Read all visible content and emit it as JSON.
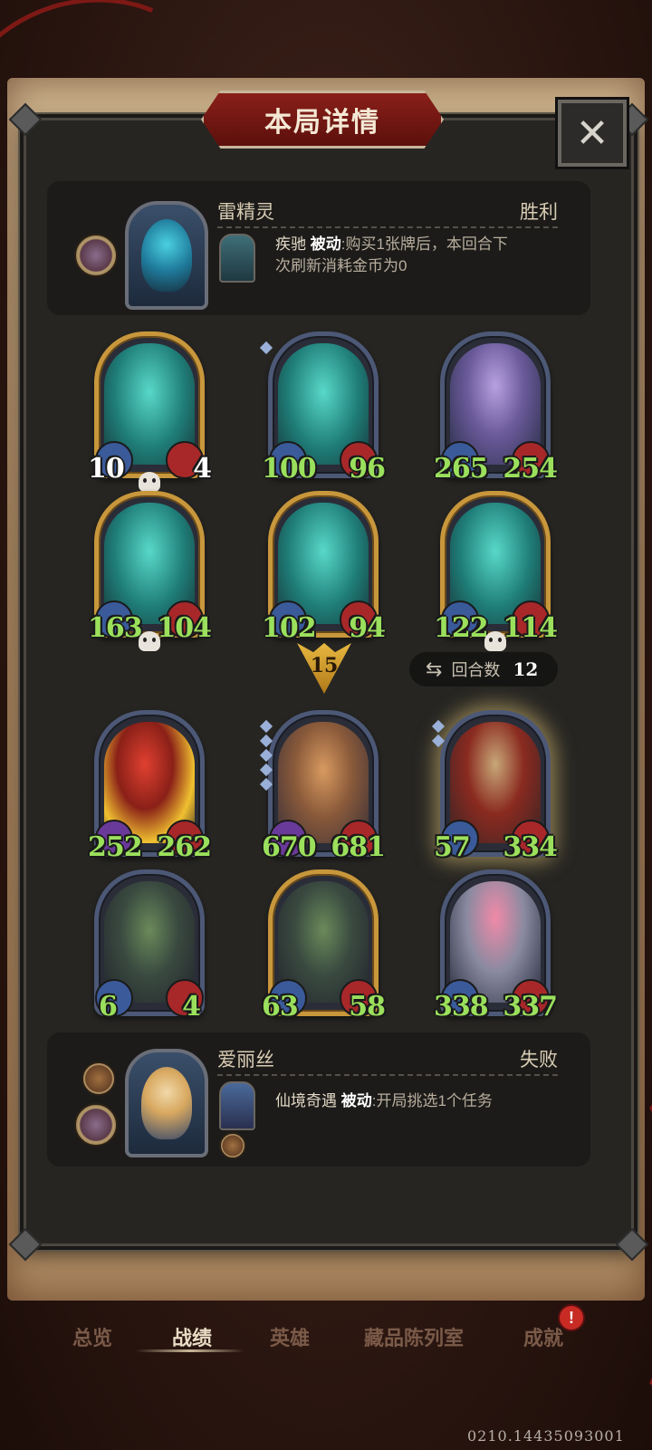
{
  "header": {
    "title": "本局详情",
    "close_label": "✕"
  },
  "top_player": {
    "name": "雷精灵",
    "result": "胜利",
    "skill_name": "疾驰",
    "skill_type": "被动",
    "skill_desc_line1": ":购买1张牌后，本回合下",
    "skill_desc_line2": "次刷新消耗金币为0"
  },
  "top_units": [
    {
      "attack": "10",
      "health": "4"
    },
    {
      "attack": "100",
      "health": "96"
    },
    {
      "attack": "265",
      "health": "254"
    },
    {
      "attack": "163",
      "health": "104"
    },
    {
      "attack": "102",
      "health": "94"
    },
    {
      "attack": "122",
      "health": "114"
    }
  ],
  "divider": {
    "turn_marker": "15",
    "rounds_label": "回合数",
    "rounds_value": "12"
  },
  "bottom_units": [
    {
      "attack": "252",
      "health": "262"
    },
    {
      "attack": "670",
      "health": "681"
    },
    {
      "attack": "57",
      "health": "334"
    },
    {
      "attack": "6",
      "health": "4"
    },
    {
      "attack": "63",
      "health": "58"
    },
    {
      "attack": "338",
      "health": "337"
    }
  ],
  "bottom_player": {
    "name": "爱丽丝",
    "result": "失败",
    "skill_name": "仙境奇遇",
    "skill_type": "被动",
    "skill_desc": ":开局挑选1个任务"
  },
  "tabs": [
    "总览",
    "战绩",
    "英雄",
    "藏品陈列室",
    "成就"
  ],
  "badge": "!",
  "footer_code": "0210.14435093001",
  "colors": {
    "panel": "#262522",
    "stat_green": "#9be05c",
    "title_red": "#8a1f19",
    "gold_frame": "#c8973c"
  }
}
